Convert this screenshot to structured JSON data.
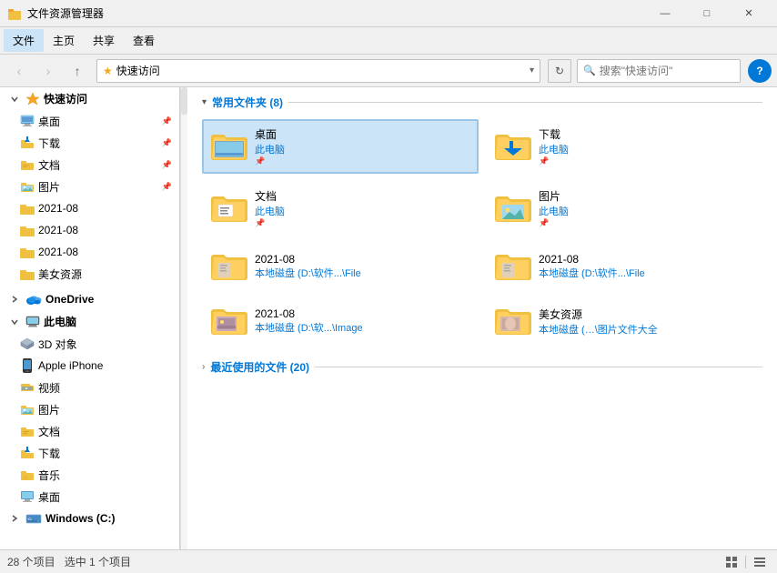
{
  "titleBar": {
    "icon": "📁",
    "title": "文件资源管理器",
    "minBtn": "—",
    "maxBtn": "□",
    "closeBtn": "✕"
  },
  "menuBar": {
    "items": [
      "文件",
      "主页",
      "共享",
      "查看"
    ]
  },
  "toolbar": {
    "back": "‹",
    "forward": "›",
    "up": "↑",
    "addressStar": "★",
    "addressPath": "快速访问",
    "addressChevron": "▾",
    "searchPlaceholder": "搜索\"快速访问\"",
    "helpLabel": "?"
  },
  "sidebar": {
    "quickAccess": {
      "label": "快速访问",
      "icon": "star"
    },
    "items": [
      {
        "label": "桌面",
        "indent": 1,
        "pin": true,
        "icon": "desktop"
      },
      {
        "label": "下载",
        "indent": 1,
        "pin": true,
        "icon": "download"
      },
      {
        "label": "文档",
        "indent": 1,
        "pin": true,
        "icon": "doc"
      },
      {
        "label": "图片",
        "indent": 1,
        "pin": true,
        "icon": "pic"
      },
      {
        "label": "2021-08",
        "indent": 1,
        "pin": false,
        "icon": "folder"
      },
      {
        "label": "2021-08",
        "indent": 1,
        "pin": false,
        "icon": "folder"
      },
      {
        "label": "2021-08",
        "indent": 1,
        "pin": false,
        "icon": "folder"
      },
      {
        "label": "美女资源",
        "indent": 1,
        "pin": false,
        "icon": "folder"
      }
    ],
    "onedrive": {
      "label": "OneDrive",
      "icon": "cloud"
    },
    "thisPC": {
      "label": "此电脑",
      "icon": "computer"
    },
    "pcItems": [
      {
        "label": "3D 对象",
        "indent": 1,
        "icon": "3d"
      },
      {
        "label": "Apple iPhone",
        "indent": 1,
        "icon": "iphone"
      },
      {
        "label": "视频",
        "indent": 1,
        "icon": "video"
      },
      {
        "label": "图片",
        "indent": 1,
        "icon": "pic2"
      },
      {
        "label": "文档",
        "indent": 1,
        "icon": "doc2"
      },
      {
        "label": "下载",
        "indent": 1,
        "icon": "download2"
      },
      {
        "label": "音乐",
        "indent": 1,
        "icon": "music"
      },
      {
        "label": "桌面",
        "indent": 1,
        "icon": "desktop2"
      }
    ],
    "windowsC": {
      "label": "Windows (C:)",
      "icon": "drive"
    }
  },
  "content": {
    "section1": {
      "label": "常用文件夹 (8)",
      "chevron": "▾"
    },
    "folders": [
      {
        "name": "桌面",
        "meta": "此电脑",
        "pin": true,
        "type": "desktop",
        "selected": true
      },
      {
        "name": "下载",
        "meta": "此电脑",
        "pin": true,
        "type": "download"
      },
      {
        "name": "文档",
        "meta": "此电脑",
        "pin": true,
        "type": "doc"
      },
      {
        "name": "图片",
        "meta": "此电脑",
        "pin": true,
        "type": "pic"
      },
      {
        "name": "2021-08",
        "meta": "本地磁盘 (D:\\软件...\\File",
        "pin": false,
        "type": "folder"
      },
      {
        "name": "2021-08",
        "meta": "本地磁盘 (D:\\软件...\\File",
        "pin": false,
        "type": "folder"
      },
      {
        "name": "2021-08",
        "meta": "本地磁盘 (D:\\软...\\Image",
        "pin": false,
        "type": "folder-img"
      },
      {
        "name": "美女资源",
        "meta": "本地磁盘 (…\\图片文件大全",
        "pin": false,
        "type": "folder-img2"
      }
    ],
    "section2": {
      "label": "最近使用的文件 (20)",
      "chevron": "›"
    }
  },
  "statusBar": {
    "left": "28 个项目",
    "selected": "选中 1 个项目",
    "viewIcon1": "⊞",
    "viewIcon2": "☰"
  }
}
